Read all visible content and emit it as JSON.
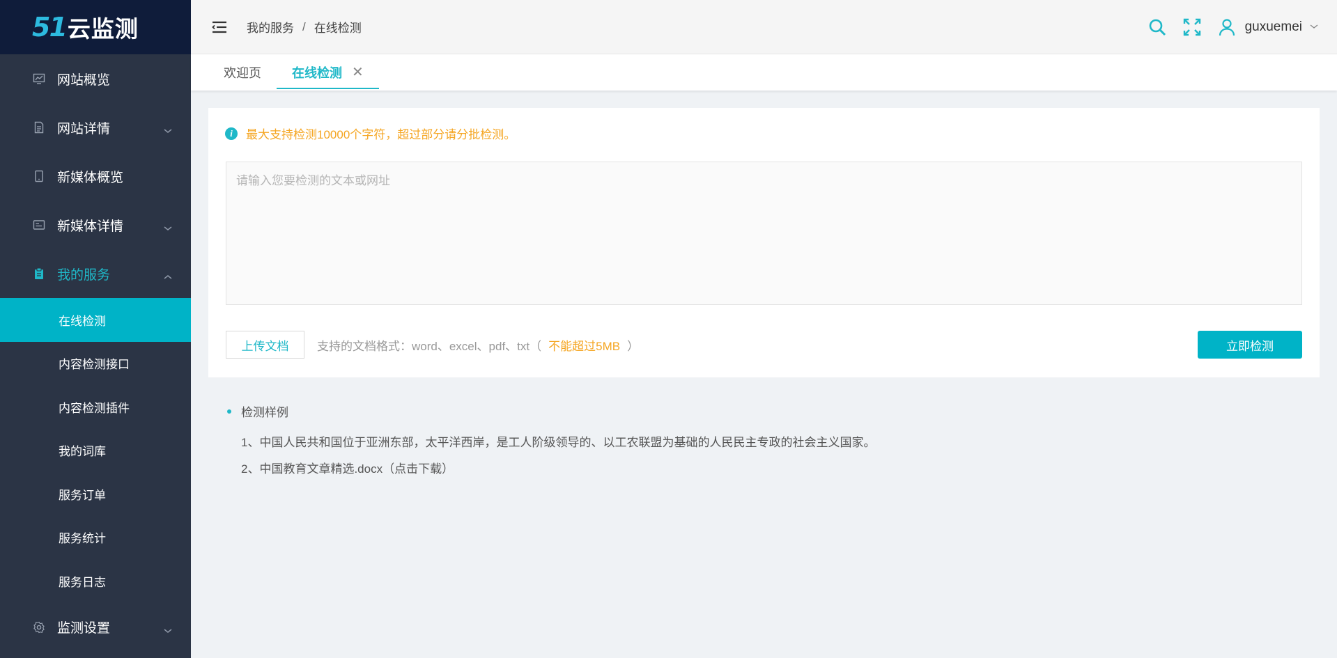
{
  "brand": {
    "logo_number": "51",
    "logo_text": "云监测"
  },
  "sidebar": {
    "items": [
      {
        "label": "网站概览",
        "icon": "chart-icon"
      },
      {
        "label": "网站详情",
        "icon": "document-icon"
      },
      {
        "label": "新媒体概览",
        "icon": "tablet-icon"
      },
      {
        "label": "新媒体详情",
        "icon": "card-icon"
      },
      {
        "label": "我的服务",
        "icon": "clipboard-icon"
      },
      {
        "label": "监测设置",
        "icon": "gear-icon"
      }
    ],
    "submenu": [
      {
        "label": "在线检测"
      },
      {
        "label": "内容检测接口"
      },
      {
        "label": "内容检测插件"
      },
      {
        "label": "我的词库"
      },
      {
        "label": "服务订单"
      },
      {
        "label": "服务统计"
      },
      {
        "label": "服务日志"
      }
    ]
  },
  "header": {
    "breadcrumb": [
      "我的服务",
      "在线检测"
    ],
    "breadcrumb_sep": "/",
    "username": "guxuemei"
  },
  "tabs": [
    {
      "label": "欢迎页"
    },
    {
      "label": "在线检测",
      "close": "✕"
    }
  ],
  "main": {
    "notice": "最大支持检测10000个字符，超过部分请分批检测。",
    "input_placeholder": "请输入您要检测的文本或网址",
    "upload_label": "上传文档",
    "formats_text": "支持的文档格式：word、excel、pdf、txt（",
    "formats_limit": "不能超过5MB",
    "formats_close": "）",
    "check_label": "立即检测"
  },
  "examples": {
    "title": "检测样例",
    "line1": "1、中国人民共和国位于亚洲东部，太平洋西岸，是工人阶级领导的、以工农联盟为基础的人民民主专政的社会主义国家。",
    "line2_prefix": "2、中国教育文章精选.docx（",
    "line2_link": "点击下载",
    "line2_suffix": "）"
  },
  "colors": {
    "accent": "#00b3c7",
    "sidebar_bg": "#2b3445",
    "logo_bg": "#0f1c3a",
    "warning": "#f5a623"
  }
}
